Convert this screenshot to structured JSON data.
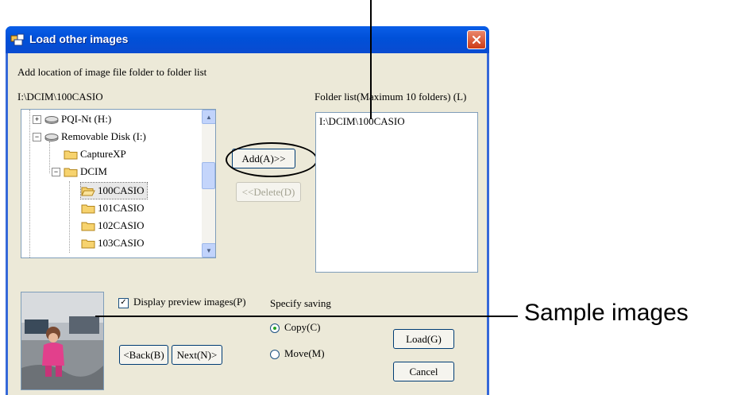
{
  "window": {
    "title": "Load other images",
    "icon": "app-window-icon",
    "close_icon": "close-icon"
  },
  "header_text": "Add location of image file folder to folder list",
  "current_path": "I:\\DCIM\\100CASIO",
  "folder_list": {
    "label": "Folder list(Maximum 10 folders) (L)",
    "items": [
      "I:\\DCIM\\100CASIO"
    ]
  },
  "tree": {
    "items": [
      {
        "label": "PQI-Nt (H:)",
        "type": "drive",
        "expander": "+"
      },
      {
        "label": "Removable Disk (I:)",
        "type": "drive",
        "expander": "−"
      },
      {
        "label": "CaptureXP",
        "type": "folder",
        "expander": ""
      },
      {
        "label": "DCIM",
        "type": "folder",
        "expander": "−"
      },
      {
        "label": "100CASIO",
        "type": "folder-open",
        "expander": "",
        "selected": true
      },
      {
        "label": "101CASIO",
        "type": "folder",
        "expander": ""
      },
      {
        "label": "102CASIO",
        "type": "folder",
        "expander": ""
      },
      {
        "label": "103CASIO",
        "type": "folder",
        "expander": ""
      }
    ]
  },
  "buttons": {
    "add": "Add(A)>>",
    "delete": "<<Delete(D)",
    "back": "<Back(B)",
    "next": "Next(N)>",
    "load": "Load(G)",
    "cancel": "Cancel"
  },
  "preview_checkbox": {
    "label": "Display preview images(P)",
    "checked": true
  },
  "saving": {
    "label": "Specify saving",
    "options": [
      {
        "label": "Copy(C)",
        "selected": true
      },
      {
        "label": "Move(M)",
        "selected": false
      }
    ]
  },
  "callout": {
    "label": "Sample images"
  },
  "colors": {
    "titlebar": "#0054e3",
    "dialog_bg": "#ece9d8",
    "close_button": "#d4431c",
    "highlight_ring": "#000000"
  }
}
